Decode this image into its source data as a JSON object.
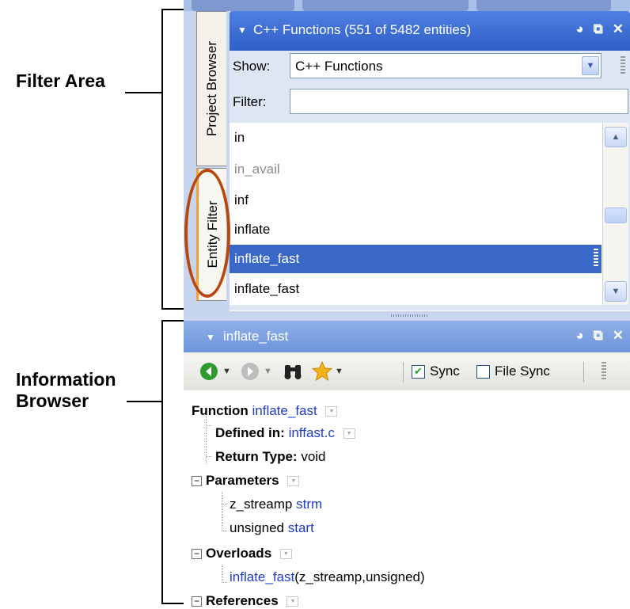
{
  "annotations": {
    "filter_area": "Filter Area",
    "information_browser_line1": "Information",
    "information_browser_line2": "Browser",
    "highlight_color": "#b7470e"
  },
  "side_tabs": {
    "project_browser": "Project Browser",
    "entity_filter": "Entity Filter"
  },
  "entity_filter": {
    "title": "C++ Functions (551 of 5482 entities)",
    "show_label": "Show:",
    "show_value": "C++ Functions",
    "filter_label": "Filter:",
    "filter_value": "",
    "items": [
      "in",
      "in_avail",
      "inf",
      "inflate",
      "inflate_fast",
      "inflate_fast"
    ],
    "selected_index": 4
  },
  "info_browser": {
    "title": "inflate_fast",
    "toolbar": {
      "sync_label": "Sync",
      "sync_checked": true,
      "file_sync_label": "File Sync",
      "file_sync_checked": false
    },
    "tree": {
      "function_label": "Function",
      "function_name": "inflate_fast",
      "defined_in_label": "Defined in:",
      "defined_in_value": "inffast.c",
      "return_type_label": "Return Type:",
      "return_type_value": "void",
      "parameters_label": "Parameters",
      "param1_type": "z_streamp",
      "param1_name": "strm",
      "param2_type": "unsigned",
      "param2_name": "start",
      "overloads_label": "Overloads",
      "overload_name": "inflate_fast",
      "overload_args": "(z_streamp,unsigned)",
      "references_label": "References"
    }
  },
  "colors": {
    "title_active": "#2f5fc8",
    "title_inactive": "#6e94db",
    "selection": "#3a68c6",
    "link": "#1f3cc8"
  }
}
